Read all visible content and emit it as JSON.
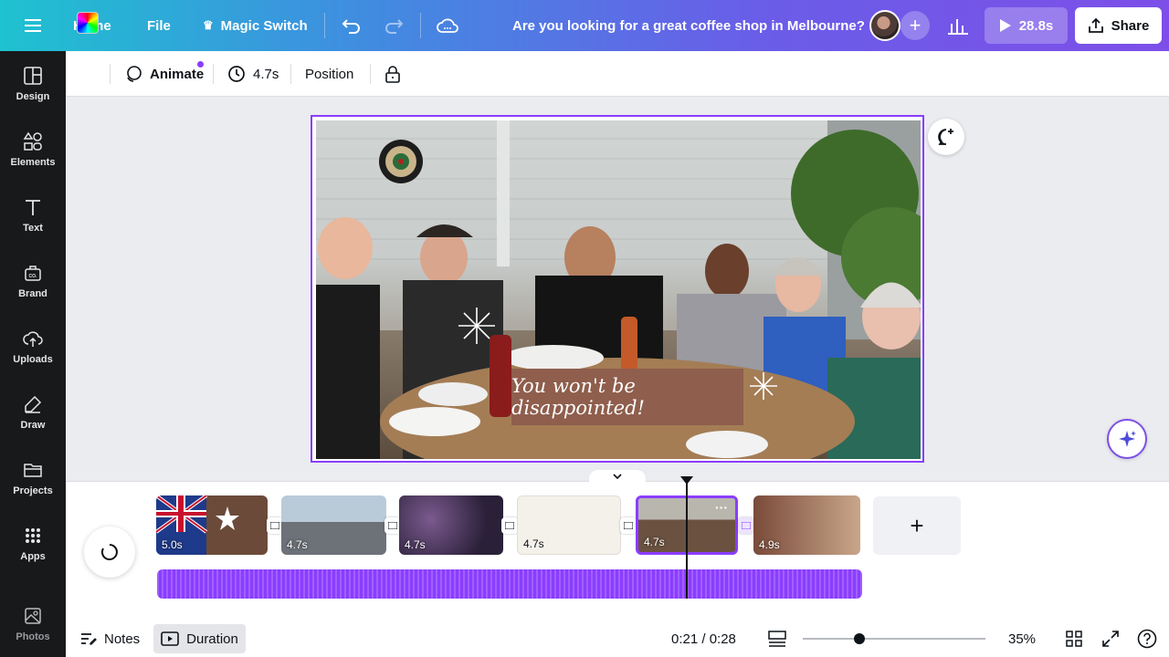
{
  "topbar": {
    "home": "Home",
    "file": "File",
    "magic_switch": "Magic Switch",
    "title": "Are you looking for a great coffee shop in Melbourne?",
    "play_duration": "28.8s",
    "share": "Share"
  },
  "sidebar": {
    "items": [
      {
        "label": "Design",
        "icon": "design-icon"
      },
      {
        "label": "Elements",
        "icon": "elements-icon"
      },
      {
        "label": "Text",
        "icon": "text-icon"
      },
      {
        "label": "Brand",
        "icon": "brand-icon"
      },
      {
        "label": "Uploads",
        "icon": "uploads-icon"
      },
      {
        "label": "Draw",
        "icon": "draw-icon"
      },
      {
        "label": "Projects",
        "icon": "folder-icon"
      },
      {
        "label": "Apps",
        "icon": "apps-icon"
      },
      {
        "label": "Photos",
        "icon": "photos-icon"
      }
    ]
  },
  "toolbar": {
    "animate": "Animate",
    "duration": "4.7s",
    "position": "Position"
  },
  "canvas": {
    "caption": "You won't be disappointed!"
  },
  "timeline": {
    "clips": [
      {
        "duration": "5.0s",
        "colors": [
          "#2b3f7a",
          "#6b4a3a"
        ]
      },
      {
        "duration": "4.7s",
        "colors": [
          "#9fb6c9",
          "#4a4e52"
        ]
      },
      {
        "duration": "4.7s",
        "colors": [
          "#2a2038",
          "#7a5a8e"
        ]
      },
      {
        "duration": "4.7s",
        "colors": [
          "#f4f1ea",
          "#d8cdb5"
        ]
      },
      {
        "duration": "4.7s",
        "colors": [
          "#b9b6ae",
          "#6b5240"
        ]
      },
      {
        "duration": "4.9s",
        "colors": [
          "#7a4b3a",
          "#c9a68a"
        ]
      }
    ]
  },
  "bottombar": {
    "notes": "Notes",
    "duration": "Duration",
    "time": "0:21 / 0:28",
    "zoom": "35%"
  },
  "colors": {
    "accent": "#8b3dff",
    "sidebar_bg": "#18191b",
    "caption_bg": "#8f5e4d"
  }
}
